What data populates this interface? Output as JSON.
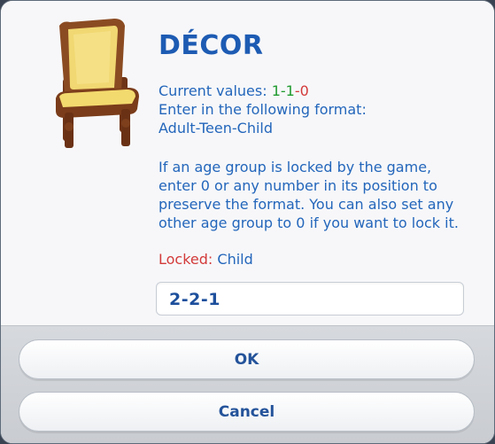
{
  "dialog": {
    "title": "DÉCOR",
    "current_values": {
      "label": "Current values: ",
      "v1": "1",
      "sep1": "-",
      "v2": "1",
      "sep2": "-",
      "v3": "0"
    },
    "format_line1": "Enter in the following format:",
    "format_line2": "Adult-Teen-Child",
    "help_text": "If an age group is locked by the game,\nenter 0 or any number in its position to\npreserve the format. You can also set any\nother age group to 0 if you want to lock it.",
    "locked_label": "Locked:",
    "locked_value": " Child",
    "input_value": "2-2-1",
    "ok_label": "OK",
    "cancel_label": "Cancel"
  },
  "colors": {
    "accent_blue": "#1d5bb3",
    "green": "#1f9a2e",
    "red": "#d33a3a"
  },
  "icons": {
    "item_image": "chair-icon"
  }
}
